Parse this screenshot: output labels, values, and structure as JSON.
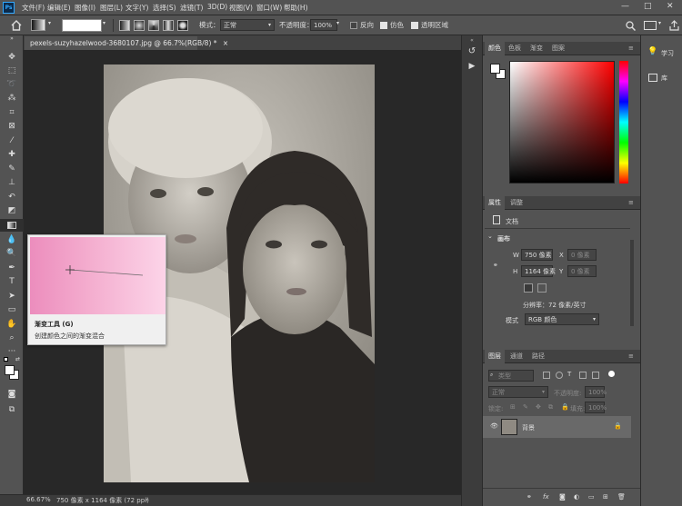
{
  "app": {
    "logo": "Ps"
  },
  "menu": [
    "文件(F)",
    "编辑(E)",
    "图像(I)",
    "图层(L)",
    "文字(Y)",
    "选择(S)",
    "滤镜(T)",
    "3D(D)",
    "视图(V)",
    "窗口(W)",
    "帮助(H)"
  ],
  "window_controls": {
    "minimize": "—",
    "restore": "□",
    "close": "✕"
  },
  "options": {
    "mode_label": "模式：",
    "mode_value": "正常",
    "opacity_label": "不透明度：",
    "opacity_value": "100%",
    "reverse_label": "反向",
    "dither_label": "仿色",
    "transparency_label": "透明区域",
    "reverse_checked": false,
    "dither_checked": true,
    "transparency_checked": true
  },
  "document_tab": {
    "title": "pexels-suzyhazelwood-3680107.jpg @ 66.7%(RGB/8) *",
    "close": "×"
  },
  "tooltip": {
    "name": "渐变工具 (G)",
    "description": "创建颜色之间的渐变混合"
  },
  "status": {
    "zoom": "66.67%",
    "info": "750 像素 x 1164 像素 (72 ppi)",
    "arrow": "›"
  },
  "color_panel": {
    "tabs": [
      "颜色",
      "色板",
      "渐变",
      "图案"
    ]
  },
  "properties_panel": {
    "tabs": [
      "属性",
      "调整"
    ],
    "doc_label": "文档",
    "section": "画布",
    "w_label": "W",
    "w_value": "750 像素",
    "x_label": "X",
    "x_placeholder": "0 像素",
    "h_label": "H",
    "h_value": "1164 像素",
    "y_label": "Y",
    "y_placeholder": "0 像素",
    "resolution": "分辨率：72 像素/英寸",
    "mode_label": "模式",
    "mode_value": "RGB 颜色"
  },
  "layers_panel": {
    "tabs": [
      "图层",
      "通道",
      "路径"
    ],
    "search_placeholder": "类型",
    "blend_mode": "正常",
    "opacity_label": "不透明度:",
    "opacity_value": "100%",
    "lock_label": "锁定:",
    "fill_label": "填充:",
    "fill_value": "100%",
    "layers": [
      {
        "name": "背景",
        "visible": true,
        "locked": true
      }
    ]
  },
  "side_panels": {
    "learn": "学习",
    "library": "库"
  },
  "colors": {
    "accent": "#31a8ff",
    "foreground": "#ffffff",
    "background": "#ffffff",
    "picker_hue": "#ff0000"
  }
}
